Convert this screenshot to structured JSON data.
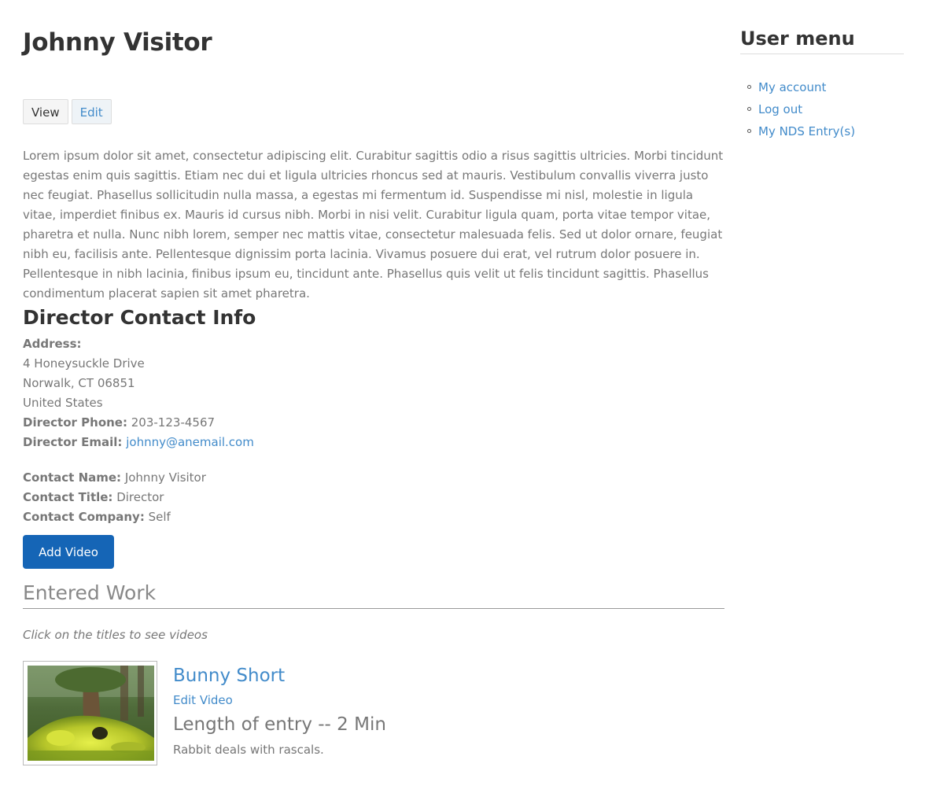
{
  "page": {
    "title": "Johnny Visitor",
    "tabs": [
      {
        "label": "View"
      },
      {
        "label": "Edit"
      }
    ],
    "bio": "Lorem ipsum dolor sit amet, consectetur adipiscing elit. Curabitur sagittis odio a risus sagittis ultricies. Morbi tincidunt egestas enim quis sagittis. Etiam nec dui et ligula ultricies rhoncus sed at mauris. Vestibulum convallis viverra justo nec feugiat. Phasellus sollicitudin nulla massa, a egestas mi fermentum id. Suspendisse mi nisl, molestie in ligula vitae, imperdiet finibus ex. Mauris id cursus nibh. Morbi in nisi velit. Curabitur ligula quam, porta vitae tempor vitae, pharetra et nulla. Nunc nibh lorem, semper nec mattis vitae, consectetur malesuada felis. Sed ut dolor ornare, feugiat nibh eu, facilisis ante. Pellentesque dignissim porta lacinia. Vivamus posuere dui erat, vel rutrum dolor posuere in. Pellentesque in nibh lacinia, finibus ipsum eu, tincidunt ante. Phasellus quis velit ut felis tincidunt sagittis. Phasellus condimentum placerat sapien sit amet pharetra."
  },
  "director": {
    "section_title": "Director Contact Info",
    "address_label": "Address:",
    "address_line1": "4 Honeysuckle Drive",
    "address_line2": "Norwalk, CT 06851",
    "address_line3": "United States",
    "phone_label": "Director Phone:",
    "phone": "203-123-4567",
    "email_label": "Director Email:",
    "email": "johnny@anemail.com"
  },
  "contact": {
    "name_label": "Contact Name:",
    "name": "Johnny Visitor",
    "title_label": "Contact Title:",
    "title": "Director",
    "company_label": "Contact Company:",
    "company": "Self"
  },
  "actions": {
    "add_video_label": "Add Video"
  },
  "entered_work": {
    "heading": "Entered Work",
    "hint": "Click on the titles to see videos",
    "items": [
      {
        "title": "Bunny Short",
        "edit_label": "Edit Video",
        "length": "Length of entry -- 2 Min",
        "description": "Rabbit deals with rascals."
      }
    ]
  },
  "sidebar": {
    "title": "User menu",
    "items": [
      {
        "label": "My account"
      },
      {
        "label": "Log out"
      },
      {
        "label": "My NDS Entry(s)"
      }
    ]
  },
  "colors": {
    "link": "#428bca",
    "button": "#1565b6",
    "heading": "#333333",
    "body_text": "#777777"
  }
}
